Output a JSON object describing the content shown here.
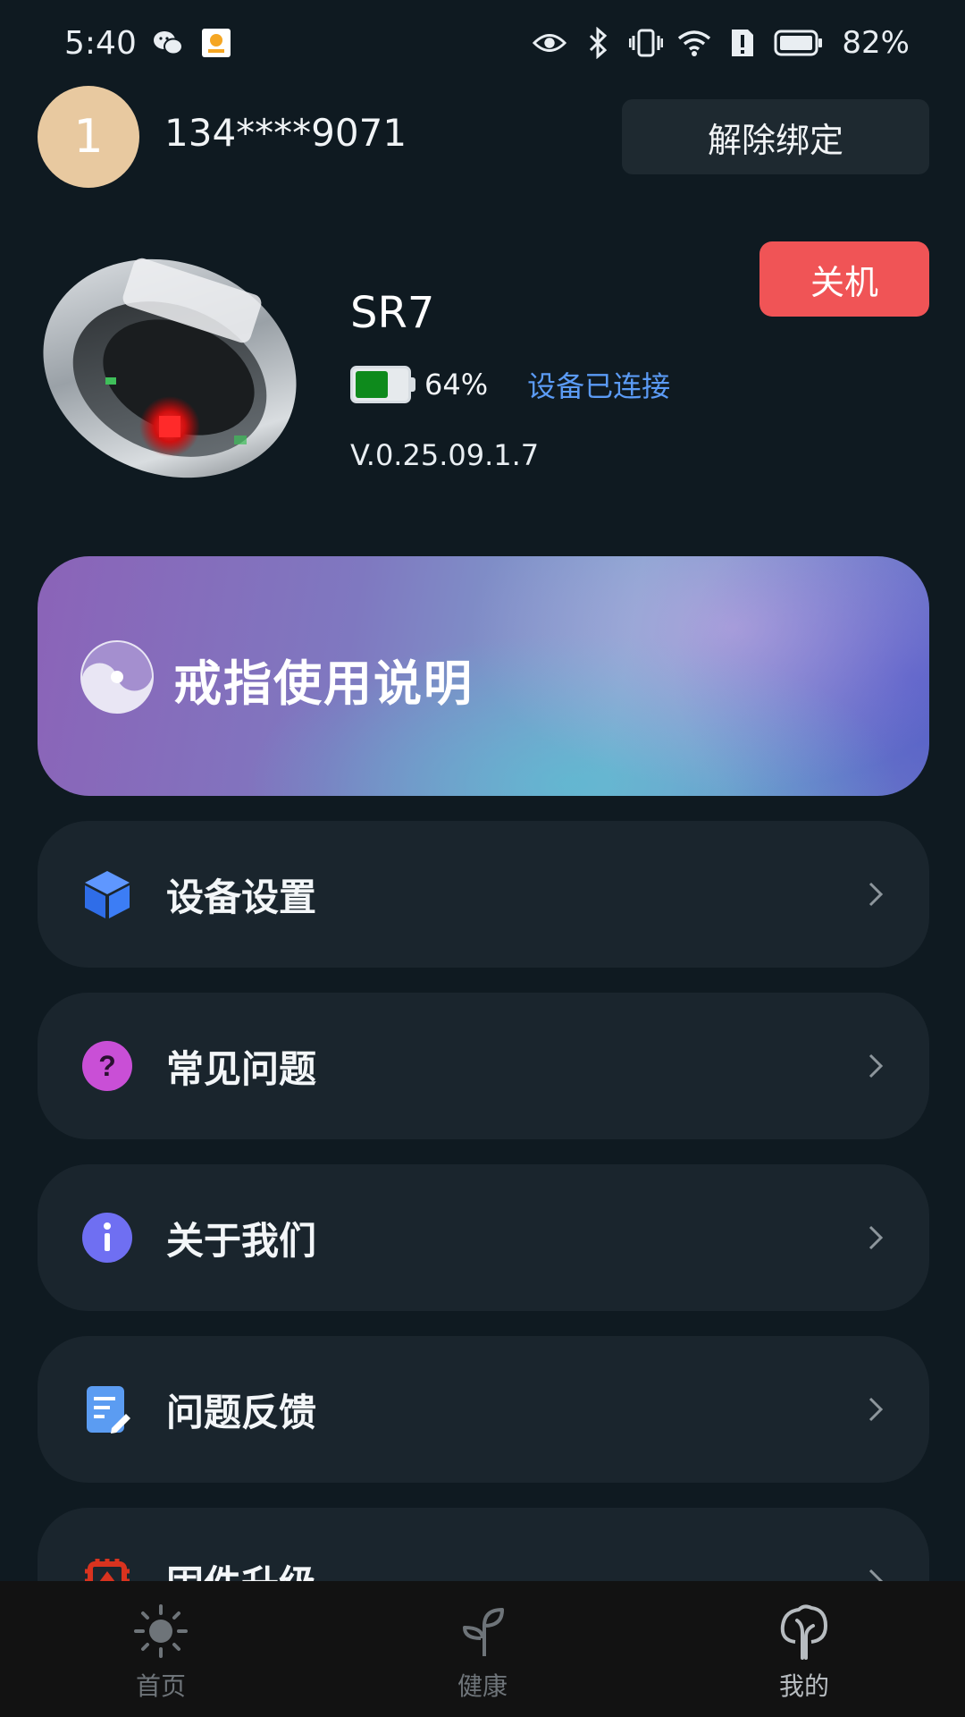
{
  "status_bar": {
    "time": "5:40",
    "battery": "82%",
    "icons": [
      "wechat-icon",
      "app-notification-icon",
      "eye-icon",
      "bluetooth-icon",
      "vibrate-icon",
      "wifi-icon",
      "alert-icon",
      "battery-icon"
    ]
  },
  "header": {
    "avatar_text": "1",
    "phone": "134****9071",
    "unbind_label": "解除绑定"
  },
  "device": {
    "name": "SR7",
    "battery_percent_value": 0.64,
    "battery_text": "64%",
    "connection_status": "设备已连接",
    "version": "V.0.25.09.1.7",
    "power_off_label": "关机",
    "image": "smart-ring-image"
  },
  "banner": {
    "title": "戒指使用说明",
    "icon": "guide-icon"
  },
  "menu": {
    "items": [
      {
        "label": "设备设置",
        "icon": "cube-icon"
      },
      {
        "label": "常见问题",
        "icon": "question-icon"
      },
      {
        "label": "关于我们",
        "icon": "info-icon"
      },
      {
        "label": "问题反馈",
        "icon": "feedback-icon"
      },
      {
        "label": "固件升级",
        "icon": "chip-icon"
      }
    ]
  },
  "bottom_nav": {
    "items": [
      {
        "label": "首页",
        "icon": "sun-icon"
      },
      {
        "label": "健康",
        "icon": "sprout-icon"
      },
      {
        "label": "我的",
        "icon": "tree-icon",
        "active": true
      }
    ]
  },
  "colors": {
    "background": "#0f1a21",
    "card": "#1a252d",
    "power_button": "#f05456",
    "link_blue": "#5b9bf5",
    "battery_green": "#0e8a1c"
  }
}
